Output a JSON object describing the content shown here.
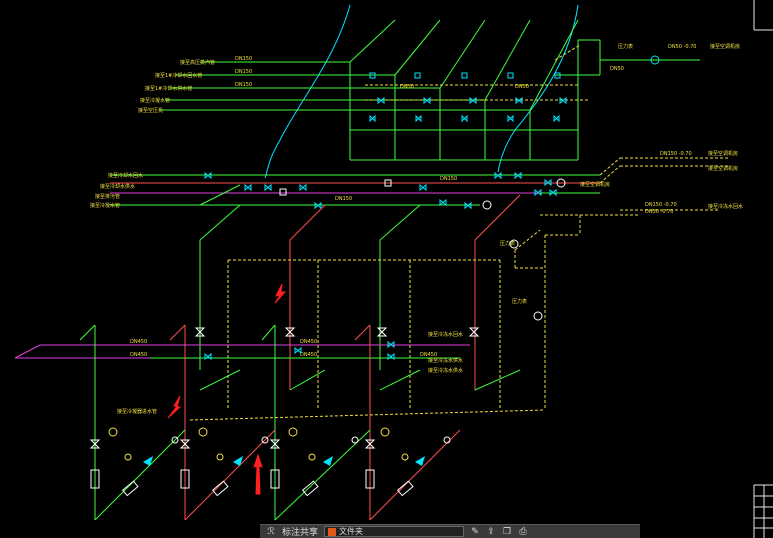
{
  "labels": {
    "main_dn": "DN450",
    "mid_dn": "DN150",
    "top_dn": "DN50",
    "pressure_gauge": "压力表",
    "r_top": "DN50 -0.70",
    "r_mid": "DN150 -0.70",
    "r_low": "DN150 -0.70",
    "r_low2": "DN50 -0.70",
    "left1": "接至高压蒸汽管",
    "left2": "接至1#冷却水回水管",
    "left3": "接至1#冷却水供水管",
    "left4": "接至冷凝水管",
    "left5": "接至空压机",
    "mid_left1": "接至冷却水回水",
    "mid_left2": "接至冷却水供水",
    "mid_left3": "接至排污管",
    "right1": "接至空调机房",
    "right2": "接至空调机房",
    "right3": "接至空调机房",
    "right4": "接至冷冻水回水",
    "center1": "接至冷冻水回水",
    "center2": "接至冷冻水供水",
    "bottom_note": "接至冷凝器进水管",
    "gauge_tag": "压力表"
  },
  "taskbar": {
    "item1": "ℛ",
    "item1_label": "标注共享",
    "doc_label": "文件夹",
    "icons": [
      "edit-icon",
      "share-icon",
      "copy-icon",
      "print-icon"
    ]
  }
}
